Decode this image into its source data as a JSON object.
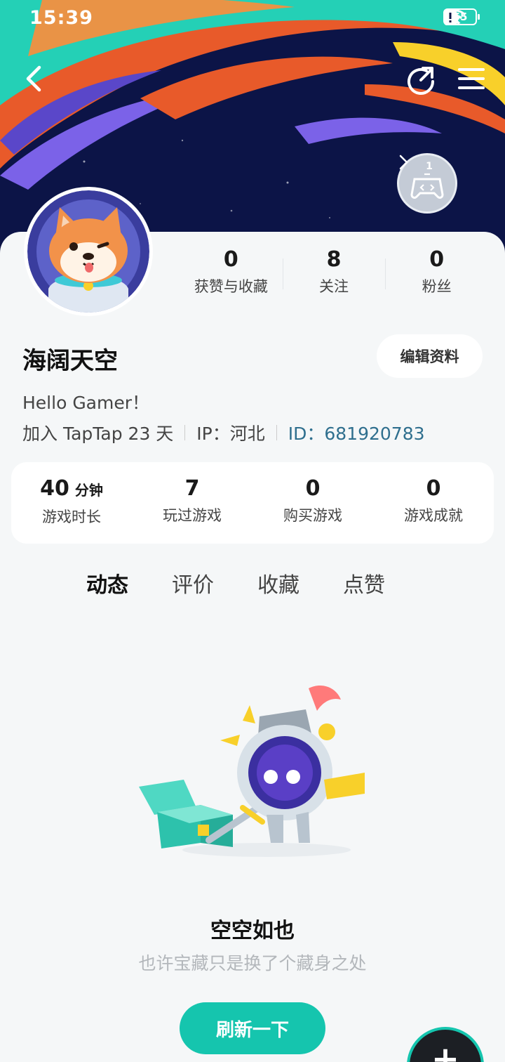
{
  "status_bar": {
    "time": "15:39",
    "battery": "65"
  },
  "profile": {
    "username": "海阔天空",
    "bio": "Hello Gamer！",
    "joined": "加入 TapTap 23 天",
    "ip": "IP：河北",
    "user_id": "ID：681920783",
    "edit_label": "编辑资料",
    "badge_level": "1"
  },
  "social_stats": [
    {
      "value": "0",
      "label": "获赞与收藏"
    },
    {
      "value": "8",
      "label": "关注"
    },
    {
      "value": "0",
      "label": "粉丝"
    }
  ],
  "game_stats": [
    {
      "value": "40",
      "unit": "分钟",
      "label": "游戏时长"
    },
    {
      "value": "7",
      "unit": "",
      "label": "玩过游戏"
    },
    {
      "value": "0",
      "unit": "",
      "label": "购买游戏"
    },
    {
      "value": "0",
      "unit": "",
      "label": "游戏成就"
    }
  ],
  "tabs": [
    {
      "label": "动态",
      "active": true
    },
    {
      "label": "评价",
      "active": false
    },
    {
      "label": "收藏",
      "active": false
    },
    {
      "label": "点赞",
      "active": false
    }
  ],
  "empty_state": {
    "title": "空空如也",
    "subtitle": "也许宝藏只是换了个藏身之处",
    "refresh_label": "刷新一下"
  },
  "icons": {
    "back": "back-arrow-icon",
    "share": "share-icon",
    "menu": "menu-icon",
    "badge": "gamepad-badge-icon",
    "fab": "plus-icon"
  },
  "colors": {
    "accent": "#15c5ae",
    "id_link": "#2f6f8e",
    "banner_bg": "#0c1447"
  }
}
